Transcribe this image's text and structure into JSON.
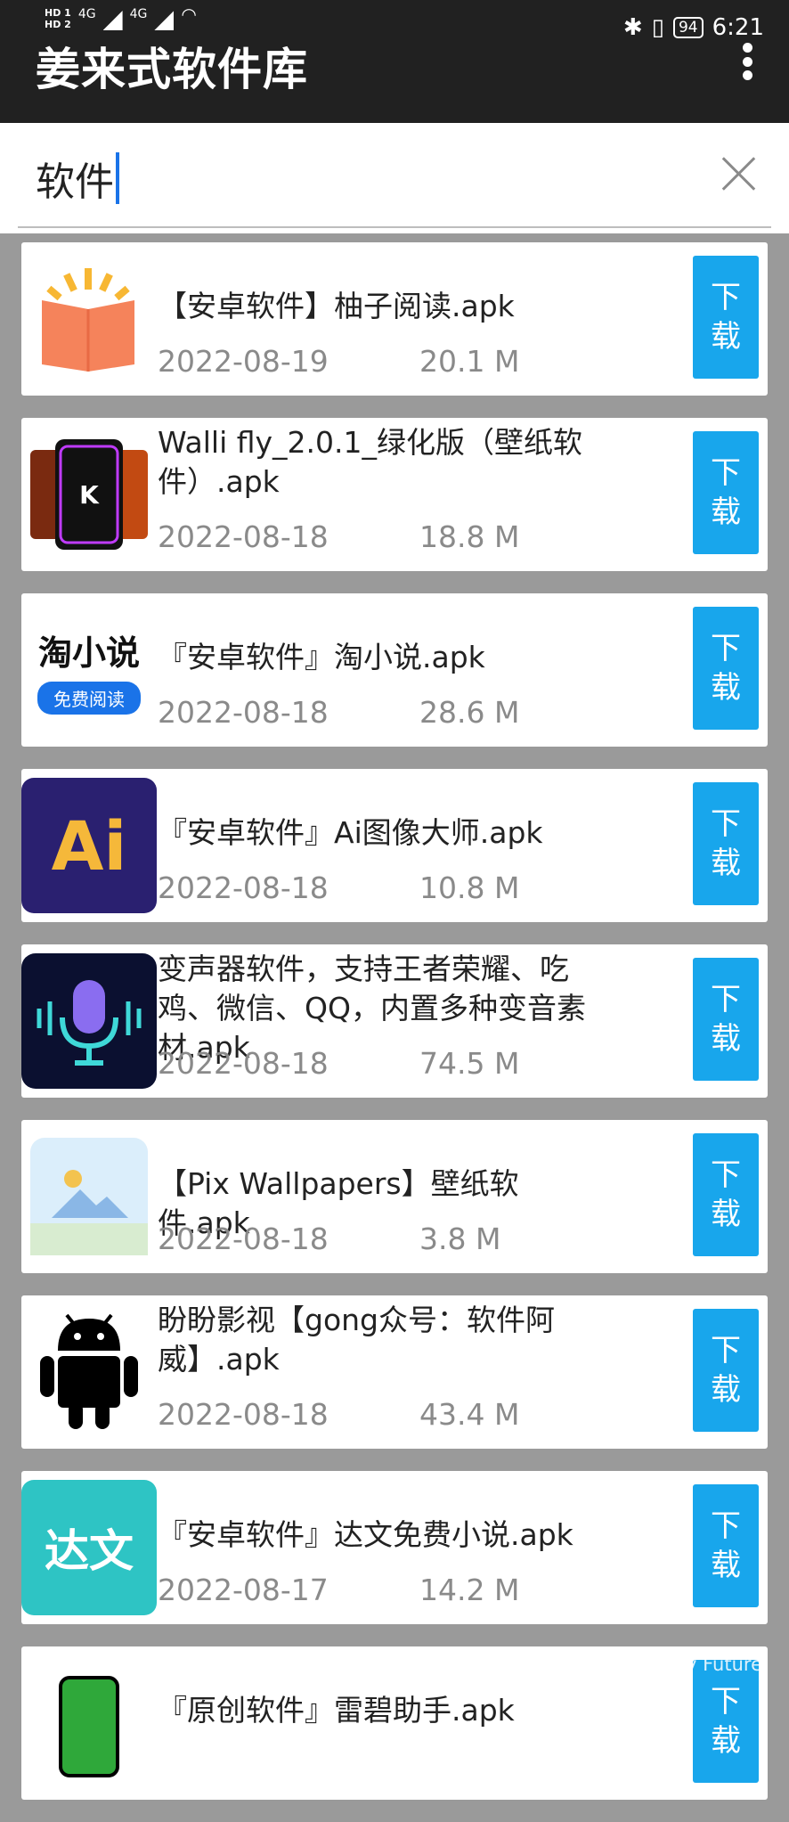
{
  "status": {
    "hd1": "HD 1",
    "hd2": "HD 2",
    "net1": "4G",
    "net2": "4G",
    "battery": "94",
    "time": "6:21"
  },
  "app": {
    "title": "姜来式软件库"
  },
  "search": {
    "query": "软件"
  },
  "download_label_1": "下",
  "download_label_2": "载",
  "items": [
    {
      "title": "【安卓软件】柚子阅读.apk",
      "date": "2022-08-19",
      "size": "20.1 M"
    },
    {
      "title": "Walli fly_2.0.1_绿化版（壁纸软件）.apk",
      "date": "2022-08-18",
      "size": "18.8 M"
    },
    {
      "title": "『安卓软件』淘小说.apk",
      "date": "2022-08-18",
      "size": "28.6 M"
    },
    {
      "title": "『安卓软件』Ai图像大师.apk",
      "date": "2022-08-18",
      "size": "10.8 M"
    },
    {
      "title": "变声器软件，支持王者荣耀、吃鸡、微信、QQ，内置多种变音素材.apk",
      "date": "2022-08-18",
      "size": "74.5 M"
    },
    {
      "title": "【Pix Wallpapers】壁纸软件.apk",
      "date": "2022-08-18",
      "size": "3.8 M"
    },
    {
      "title": "盼盼影视【gong众号：软件阿威】.apk",
      "date": "2022-08-18",
      "size": "43.4 M"
    },
    {
      "title": "『安卓软件』达文免费小说.apk",
      "date": "2022-08-17",
      "size": "14.2 M"
    },
    {
      "title": "『原创软件』雷碧助手.apk",
      "date": "",
      "size": ""
    }
  ],
  "thumbs": {
    "taoxiaoshuo": "淘小说",
    "taoxiaoshuo_sub": "免费阅读",
    "ai": "Ai",
    "dawen": "达文"
  },
  "watermark": "For My Future",
  "colors": {
    "appbar": "#212121",
    "accent": "#18a6ec",
    "background": "#9a9a9a"
  }
}
